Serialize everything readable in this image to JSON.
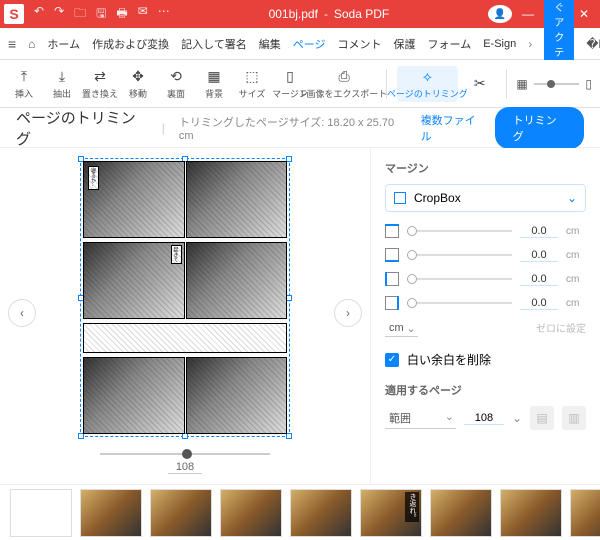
{
  "titlebar": {
    "file": "001bj.pdf",
    "app": "Soda PDF",
    "logo": "S"
  },
  "menubar": {
    "items": [
      "ホーム",
      "作成および変換",
      "記入して署名",
      "編集",
      "ページ",
      "コメント",
      "保護",
      "フォーム",
      "E-Sign"
    ],
    "activate": "今すぐアクティベート"
  },
  "toolbar": {
    "tools": [
      {
        "icon": "⤒",
        "label": "挿入"
      },
      {
        "icon": "⤓",
        "label": "抽出"
      },
      {
        "icon": "⇄",
        "label": "置き換え"
      },
      {
        "icon": "✥",
        "label": "移動"
      },
      {
        "icon": "⟲",
        "label": "裏面"
      },
      {
        "icon": "▦",
        "label": "背景"
      },
      {
        "icon": "⬚",
        "label": "サイズ"
      },
      {
        "icon": "▯",
        "label": "マージン"
      },
      {
        "icon": "⎙",
        "label": "F画像をエクスポート"
      },
      {
        "icon": "⟡",
        "label": "ページのトリミング"
      },
      {
        "icon": "✂",
        "label": ""
      }
    ]
  },
  "subheader": {
    "title": "ページのトリミング",
    "info": "トリミングしたページサイズ: 18.20 x 25.70 cm",
    "multi": "複数ファイル",
    "trim": "トリミング"
  },
  "preview": {
    "page_number": "108"
  },
  "sidebar": {
    "margin_label": "マージン",
    "cropbox": "CropBox",
    "margins": [
      {
        "v": "0.0",
        "u": "cm"
      },
      {
        "v": "0.0",
        "u": "cm"
      },
      {
        "v": "0.0",
        "u": "cm"
      },
      {
        "v": "0.0",
        "u": "cm"
      }
    ],
    "unit": "cm",
    "reset": "ゼロに設定",
    "whitespace": "白い余白を削除",
    "apply_label": "適用するページ",
    "range": "範囲",
    "page_val": "108"
  },
  "thumbs": {
    "label": "き返れ。"
  }
}
